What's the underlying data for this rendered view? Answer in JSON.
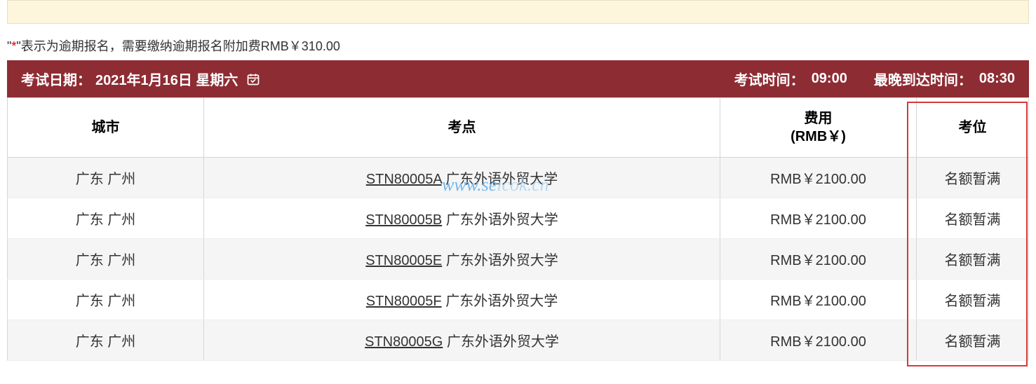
{
  "notice": {
    "prefix": "\"",
    "asterisk": "*",
    "suffix": "\"表示为逾期报名，需要缴纳逾期报名附加费RMB￥310.00"
  },
  "header": {
    "exam_date_label": "考试日期：",
    "exam_date_value": "2021年1月16日 星期六",
    "exam_time_label": "考试时间：",
    "exam_time_value": "09:00",
    "arrive_time_label": "最晚到达时间：",
    "arrive_time_value": "08:30"
  },
  "columns": {
    "city": "城市",
    "site": "考点",
    "fee_line1": "费用",
    "fee_line2": "(RMB￥)",
    "seat": "考位"
  },
  "rows": [
    {
      "city": "广东 广州",
      "code": "STN80005A",
      "site": " 广东外语外贸大学",
      "fee": "RMB￥2100.00",
      "seat": "名额暂满"
    },
    {
      "city": "广东 广州",
      "code": "STN80005B",
      "site": " 广东外语外贸大学",
      "fee": "RMB￥2100.00",
      "seat": "名额暂满"
    },
    {
      "city": "广东 广州",
      "code": "STN80005E",
      "site": " 广东外语外贸大学",
      "fee": "RMB￥2100.00",
      "seat": "名额暂满"
    },
    {
      "city": "广东 广州",
      "code": "STN80005F",
      "site": " 广东外语外贸大学",
      "fee": "RMB￥2100.00",
      "seat": "名额暂满"
    },
    {
      "city": "广东 广州",
      "code": "STN80005G",
      "site": " 广东外语外贸大学",
      "fee": "RMB￥2100.00",
      "seat": "名额暂满"
    }
  ],
  "watermark": {
    "part1": "www.se",
    "part2": "icok.cn"
  }
}
